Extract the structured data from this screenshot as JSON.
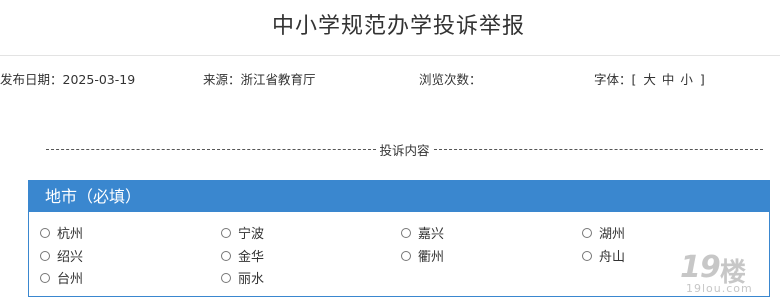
{
  "header": {
    "title": "中小学规范办学投诉举报"
  },
  "meta": {
    "date_label": "发布日期：",
    "date_value": "2025-03-19",
    "source_label": "来源：",
    "source_value": "浙江省教育厅",
    "views_label": "浏览次数：",
    "font_label": "字体：",
    "font_open": "[",
    "font_options": [
      "大",
      "中",
      "小"
    ],
    "font_close": "]"
  },
  "divider": {
    "label": "投诉内容"
  },
  "district_field": {
    "title": "地市（必填）",
    "options": [
      {
        "label": "杭州",
        "selected": false
      },
      {
        "label": "宁波",
        "selected": false
      },
      {
        "label": "嘉兴",
        "selected": false
      },
      {
        "label": "湖州",
        "selected": false
      },
      {
        "label": "绍兴",
        "selected": false
      },
      {
        "label": "金华",
        "selected": false
      },
      {
        "label": "衢州",
        "selected": false
      },
      {
        "label": "舟山",
        "selected": false
      },
      {
        "label": "台州",
        "selected": false
      },
      {
        "label": "丽水",
        "selected": false
      }
    ]
  },
  "watermark": {
    "number": "19",
    "glyph": "楼",
    "url": "19lou.com"
  },
  "colors": {
    "accent": "#3a87cf",
    "text": "#333333",
    "watermark": "#c7c7c7"
  }
}
